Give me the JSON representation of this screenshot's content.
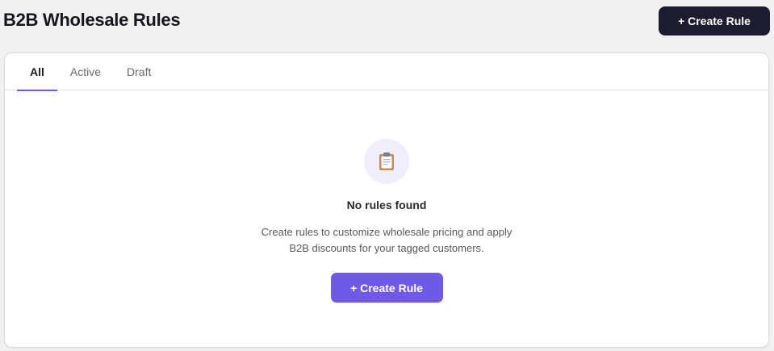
{
  "header": {
    "title": "B2B Wholesale Rules",
    "create_button_label": "+ Create Rule"
  },
  "tabs": [
    {
      "label": "All",
      "active": true
    },
    {
      "label": "Active",
      "active": false
    },
    {
      "label": "Draft",
      "active": false
    }
  ],
  "empty_state": {
    "icon": "clipboard-icon",
    "title": "No rules found",
    "description_line1": "Create rules to customize wholesale pricing and apply",
    "description_line2": "B2B discounts for your tagged customers.",
    "create_button_label": "+ Create Rule"
  },
  "colors": {
    "accent": "#6e5ae6",
    "dark_button": "#1c1b2f",
    "icon_bg": "#f1eefc",
    "page_bg": "#f1f1f1"
  }
}
